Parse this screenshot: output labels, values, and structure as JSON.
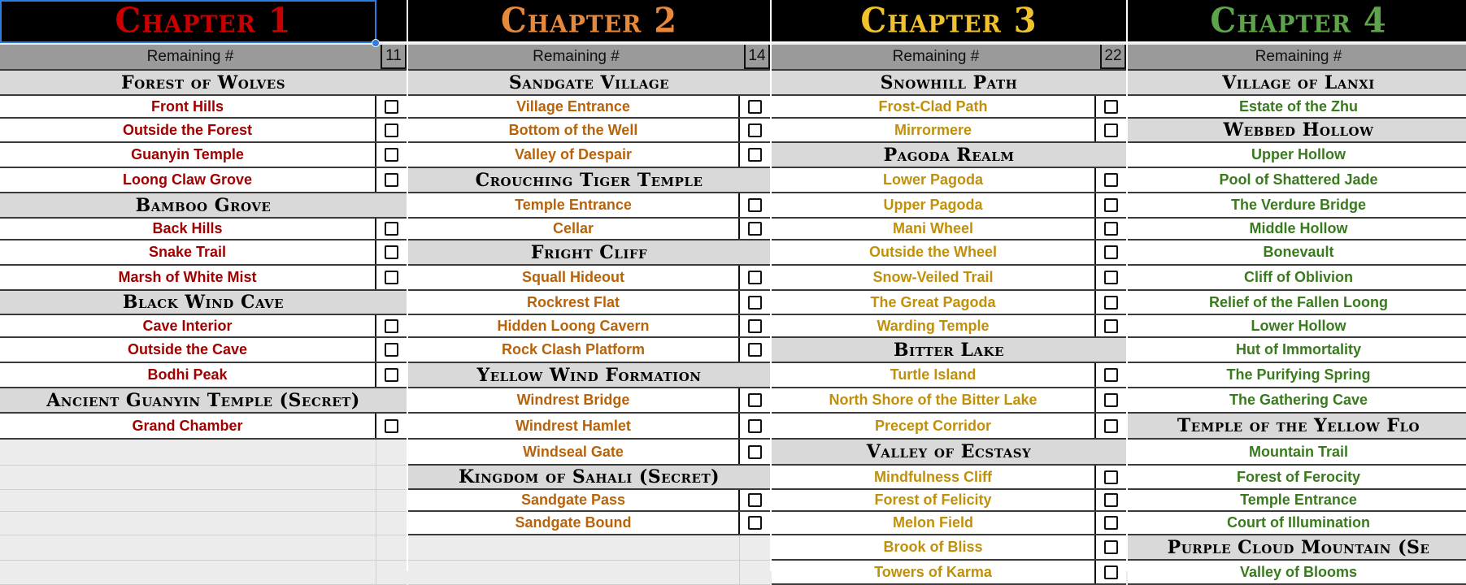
{
  "colors": {
    "ch1": "#c80000",
    "ch2": "#e8883a",
    "ch3": "#f2c22e",
    "ch4": "#5ea44a",
    "loc1": "#a00000",
    "loc2": "#b8620a",
    "loc3": "#c0900a",
    "loc4": "#3a7a1e"
  },
  "remaining_label": "Remaining #",
  "chapters": [
    {
      "title": "Chapter 1",
      "remaining": "11",
      "rows": [
        {
          "type": "sec",
          "text": "Forest of Wolves"
        },
        {
          "type": "loc",
          "text": "Front Hills"
        },
        {
          "type": "loc",
          "text": "Outside the Forest"
        },
        {
          "type": "loc",
          "text": "Guanyin Temple"
        },
        {
          "type": "loc",
          "text": "Loong Claw Grove"
        },
        {
          "type": "sec",
          "text": "Bamboo Grove"
        },
        {
          "type": "loc",
          "text": "Back Hills"
        },
        {
          "type": "loc",
          "text": "Snake Trail"
        },
        {
          "type": "loc",
          "text": "Marsh of White Mist"
        },
        {
          "type": "sec",
          "text": "Black Wind Cave"
        },
        {
          "type": "loc",
          "text": "Cave Interior"
        },
        {
          "type": "loc",
          "text": "Outside the Cave"
        },
        {
          "type": "loc",
          "text": "Bodhi Peak"
        },
        {
          "type": "sec",
          "text": "Ancient Guanyin Temple (Secret)"
        },
        {
          "type": "loc",
          "text": "Grand Chamber"
        },
        {
          "type": "empty"
        },
        {
          "type": "empty"
        },
        {
          "type": "empty"
        },
        {
          "type": "empty"
        },
        {
          "type": "empty"
        },
        {
          "type": "empty"
        },
        {
          "type": "empty"
        }
      ]
    },
    {
      "title": "Chapter 2",
      "remaining": "14",
      "rows": [
        {
          "type": "sec",
          "text": "Sandgate Village"
        },
        {
          "type": "loc",
          "text": "Village Entrance"
        },
        {
          "type": "loc",
          "text": "Bottom of the Well"
        },
        {
          "type": "loc",
          "text": "Valley of Despair"
        },
        {
          "type": "sec",
          "text": "Crouching Tiger Temple"
        },
        {
          "type": "loc",
          "text": "Temple Entrance"
        },
        {
          "type": "loc",
          "text": "Cellar"
        },
        {
          "type": "sec",
          "text": "Fright Cliff"
        },
        {
          "type": "loc",
          "text": "Squall Hideout"
        },
        {
          "type": "loc",
          "text": "Rockrest Flat"
        },
        {
          "type": "loc",
          "text": "Hidden Loong Cavern"
        },
        {
          "type": "loc",
          "text": "Rock Clash Platform"
        },
        {
          "type": "sec",
          "text": "Yellow Wind Formation"
        },
        {
          "type": "loc",
          "text": "Windrest Bridge"
        },
        {
          "type": "loc",
          "text": "Windrest Hamlet"
        },
        {
          "type": "loc",
          "text": "Windseal Gate"
        },
        {
          "type": "sec",
          "text": "Kingdom of Sahali (Secret)"
        },
        {
          "type": "loc",
          "text": "Sandgate Pass"
        },
        {
          "type": "loc",
          "text": "Sandgate Bound"
        },
        {
          "type": "empty"
        },
        {
          "type": "empty"
        },
        {
          "type": "empty"
        }
      ]
    },
    {
      "title": "Chapter 3",
      "remaining": "22",
      "rows": [
        {
          "type": "sec",
          "text": "Snowhill Path"
        },
        {
          "type": "loc",
          "text": "Frost-Clad Path"
        },
        {
          "type": "loc",
          "text": "Mirrormere"
        },
        {
          "type": "sec",
          "text": "Pagoda Realm"
        },
        {
          "type": "loc",
          "text": "Lower Pagoda"
        },
        {
          "type": "loc",
          "text": "Upper Pagoda"
        },
        {
          "type": "loc",
          "text": "Mani Wheel"
        },
        {
          "type": "loc",
          "text": "Outside the Wheel"
        },
        {
          "type": "loc",
          "text": "Snow-Veiled Trail"
        },
        {
          "type": "loc",
          "text": "The Great Pagoda"
        },
        {
          "type": "loc",
          "text": "Warding Temple"
        },
        {
          "type": "sec",
          "text": "Bitter Lake"
        },
        {
          "type": "loc",
          "text": "Turtle Island"
        },
        {
          "type": "loc",
          "text": "North Shore of the Bitter Lake"
        },
        {
          "type": "loc",
          "text": "Precept Corridor"
        },
        {
          "type": "sec",
          "text": "Valley of Ecstasy"
        },
        {
          "type": "loc",
          "text": "Mindfulness Cliff"
        },
        {
          "type": "loc",
          "text": "Forest of Felicity"
        },
        {
          "type": "loc",
          "text": "Melon Field"
        },
        {
          "type": "loc",
          "text": "Brook of Bliss"
        },
        {
          "type": "loc",
          "text": "Towers of Karma"
        }
      ]
    },
    {
      "title": "Chapter 4",
      "remaining": "",
      "rows": [
        {
          "type": "sec",
          "text": "Village of Lanxi"
        },
        {
          "type": "loc",
          "text": "Estate of the Zhu"
        },
        {
          "type": "sec",
          "text": "Webbed Hollow"
        },
        {
          "type": "loc",
          "text": "Upper Hollow"
        },
        {
          "type": "loc",
          "text": "Pool of Shattered Jade"
        },
        {
          "type": "loc",
          "text": "The Verdure Bridge"
        },
        {
          "type": "loc",
          "text": "Middle Hollow"
        },
        {
          "type": "loc",
          "text": "Bonevault"
        },
        {
          "type": "loc",
          "text": "Cliff of Oblivion"
        },
        {
          "type": "loc",
          "text": "Relief of the Fallen Loong"
        },
        {
          "type": "loc",
          "text": "Lower Hollow"
        },
        {
          "type": "loc",
          "text": "Hut of Immortality"
        },
        {
          "type": "loc",
          "text": "The Purifying Spring"
        },
        {
          "type": "loc",
          "text": "The Gathering Cave"
        },
        {
          "type": "sec",
          "text": "Temple of the Yellow Flo"
        },
        {
          "type": "loc",
          "text": "Mountain Trail"
        },
        {
          "type": "loc",
          "text": "Forest of Ferocity"
        },
        {
          "type": "loc",
          "text": "Temple Entrance"
        },
        {
          "type": "loc",
          "text": "Court of Illumination"
        },
        {
          "type": "sec",
          "text": "Purple Cloud Mountain (Se"
        },
        {
          "type": "loc",
          "text": "Valley of Blooms"
        }
      ]
    }
  ]
}
